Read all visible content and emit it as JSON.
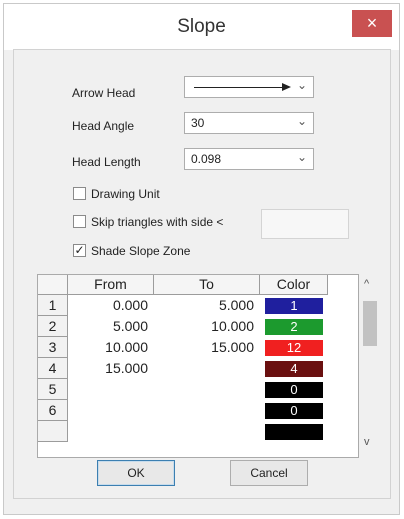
{
  "window": {
    "title": "Slope",
    "close_glyph": "×"
  },
  "fields": {
    "arrow_head_label": "Arrow Head",
    "head_angle_label": "Head Angle",
    "head_angle_value": "30",
    "head_length_label": "Head Length",
    "head_length_value": "0.098"
  },
  "checks": {
    "drawing_unit": {
      "label": "Drawing Unit",
      "checked": false
    },
    "skip_triangles": {
      "label": "Skip triangles with side <",
      "checked": false
    },
    "shade_slope": {
      "label": "Shade Slope Zone",
      "checked": true,
      "mark": "✓"
    }
  },
  "table": {
    "headers": [
      "From",
      "To",
      "Color"
    ],
    "rows": [
      {
        "n": "1",
        "from": "0.000",
        "to": "5.000",
        "color_label": "1",
        "color": "#1f1f9e"
      },
      {
        "n": "2",
        "from": "5.000",
        "to": "10.000",
        "color_label": "2",
        "color": "#1c9a2e"
      },
      {
        "n": "3",
        "from": "10.000",
        "to": "15.000",
        "color_label": "12",
        "color": "#f02020"
      },
      {
        "n": "4",
        "from": "15.000",
        "to": "",
        "color_label": "4",
        "color": "#6a1010"
      },
      {
        "n": "5",
        "from": "",
        "to": "",
        "color_label": "0",
        "color": "#000000"
      },
      {
        "n": "6",
        "from": "",
        "to": "",
        "color_label": "0",
        "color": "#000000"
      }
    ]
  },
  "buttons": {
    "ok": "OK",
    "cancel": "Cancel"
  },
  "scroll": {
    "up": "^",
    "down": "v"
  },
  "icons": {
    "dropdown": "chevron-down-icon",
    "close": "close-icon",
    "check": "checkmark-icon"
  },
  "colors": {
    "close_bg": "#c95151",
    "dialog_bg": "#f0f0f0"
  }
}
